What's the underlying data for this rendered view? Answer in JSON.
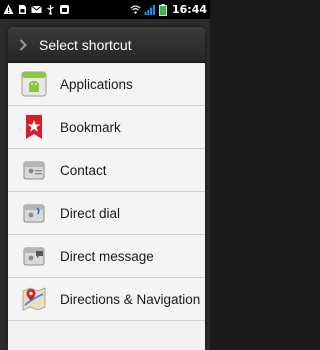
{
  "status_bar": {
    "icons": [
      "warning-icon",
      "sim-card-icon",
      "mail-icon",
      "usb-icon",
      "android-icon",
      "wifi-icon",
      "signal-icon",
      "battery-icon"
    ],
    "time": "16:44"
  },
  "dialog": {
    "title": "Select shortcut",
    "items": [
      {
        "label": "Applications",
        "icon": "applications-icon"
      },
      {
        "label": "Bookmark",
        "icon": "bookmark-icon"
      },
      {
        "label": "Contact",
        "icon": "contact-icon"
      },
      {
        "label": "Direct dial",
        "icon": "direct-dial-icon"
      },
      {
        "label": "Direct message",
        "icon": "direct-message-icon"
      },
      {
        "label": "Directions & Navigation",
        "icon": "directions-icon"
      }
    ]
  },
  "colors": {
    "header_bg": "#2e2e2e",
    "list_bg": "#f4f4f4",
    "bookmark_red": "#d1202a",
    "app_green": "#8dc63f"
  }
}
